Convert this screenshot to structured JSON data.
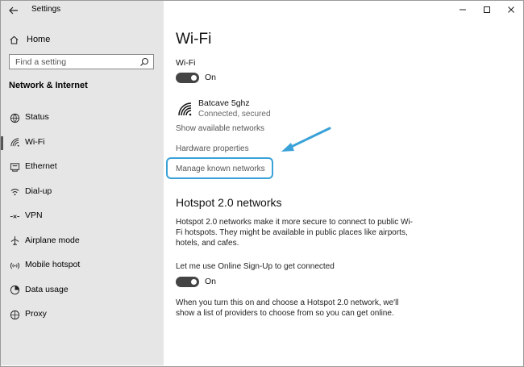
{
  "titlebar": {
    "app_title": "Settings"
  },
  "sidebar": {
    "home_label": "Home",
    "search_placeholder": "Find a setting",
    "section_title": "Network & Internet",
    "items": [
      {
        "label": "Status",
        "icon": "globe-icon"
      },
      {
        "label": "Wi-Fi",
        "icon": "wifi-icon",
        "active": true
      },
      {
        "label": "Ethernet",
        "icon": "ethernet-icon"
      },
      {
        "label": "Dial-up",
        "icon": "dialup-icon"
      },
      {
        "label": "VPN",
        "icon": "vpn-icon"
      },
      {
        "label": "Airplane mode",
        "icon": "airplane-icon"
      },
      {
        "label": "Mobile hotspot",
        "icon": "hotspot-icon"
      },
      {
        "label": "Data usage",
        "icon": "data-usage-icon"
      },
      {
        "label": "Proxy",
        "icon": "proxy-icon"
      }
    ]
  },
  "main": {
    "title": "Wi-Fi",
    "wifi_label": "Wi-Fi",
    "wifi_toggle_state": "On",
    "network": {
      "name": "Batcave 5ghz",
      "status": "Connected, secured"
    },
    "show_networks": "Show available networks",
    "hardware_properties": "Hardware properties",
    "manage_known": "Manage known networks",
    "hotspot_title": "Hotspot 2.0 networks",
    "hotspot_desc": "Hotspot 2.0 networks make it more secure to connect to public Wi-Fi hotspots. They might be available in public places like airports, hotels, and cafes.",
    "online_signup_label": "Let me use Online Sign-Up to get connected",
    "online_signup_state": "On",
    "online_signup_desc": "When you turn this on and choose a Hotspot 2.0 network, we'll show a list of providers to choose from so you can get online."
  },
  "colors": {
    "highlight": "#3aa2d8",
    "sidebar_bg": "#e6e6e6",
    "toggle_on": "#444444"
  }
}
